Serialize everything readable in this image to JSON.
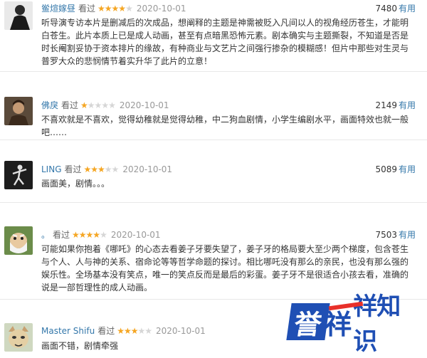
{
  "reviews": [
    {
      "user": "鲎煊嫁昼",
      "watched": "看过",
      "rating": 4,
      "date": "2020-10-01",
      "votes": "7480",
      "useful": "有用",
      "avatar": "man-portrait-avatar",
      "text": "听导演专访本片是删减后的次成品，想阐释的主题是神需被贬入凡间以人的视角经历苍生，才能明白苍生。此片本质上已是成人动画，甚至有点暗黑恐怖元素。剧本确实与主题撕裂，不知道是否是时长阉割妥协于资本排片的缘故，有种商业与文艺片之间强行掺杂的模糊感！但片中那些对生灵与普罗大众的悲悯情节着实升华了此片的立意！"
    },
    {
      "user": "佛戾",
      "watched": "看过",
      "rating": 1,
      "date": "2020-10-01",
      "votes": "2149",
      "useful": "有用",
      "avatar": "warrior-portrait-avatar",
      "text": "不喜欢就是不喜欢，觉得幼稚就是觉得幼稚，中二狗血剧情，小学生编剧水平，画面特效也就一般吧……"
    },
    {
      "user": "LING",
      "watched": "看过",
      "rating": 3,
      "date": "2020-10-01",
      "votes": "5089",
      "useful": "有用",
      "avatar": "dancer-silhouette-avatar",
      "text": "画面美，剧情。。。"
    },
    {
      "user": "。",
      "watched": "看过",
      "rating": 4,
      "date": "2020-10-01",
      "votes": "7503",
      "useful": "有用",
      "avatar": "cartoon-elder-avatar",
      "text": "可能如果你抱着《哪吒》的心态去看姜子牙要失望了，姜子牙的格局要大至少两个梯度，包含苍生与个人、人与神的关系、宿命论等等哲学命题的探讨。相比哪吒没有那么的亲民，也没有那么强的娱乐性。全场基本没有笑点，唯一的笑点反而是最后的彩蛋。姜子牙不是很适合小孩去看，准确的说是一部哲理性的成人动画。"
    },
    {
      "user": "Master Shifu",
      "watched": "看过",
      "rating": 3,
      "date": "2020-10-01",
      "votes": "",
      "useful": "",
      "avatar": "red-panda-avatar",
      "text": "画面不错，剧情牵强"
    }
  ],
  "watermark": {
    "char1": "誉",
    "char2": "祥",
    "rest": "祥知识"
  },
  "colors": {
    "username": "#3377aa",
    "star": "#f5a623",
    "watermark_blue": "#1f4fb4",
    "watermark_red": "#e8302a"
  }
}
